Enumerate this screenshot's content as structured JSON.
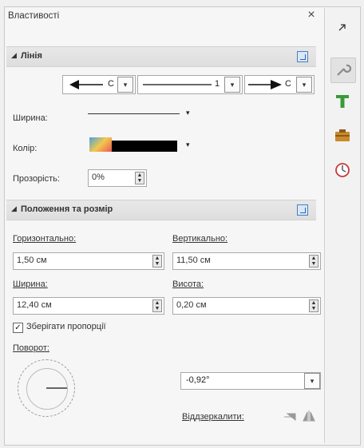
{
  "panel": {
    "title": "Властивості",
    "close_glyph": "×"
  },
  "line_section": {
    "header": "Лінія",
    "start_arrow_value": "С",
    "mid_value": "1",
    "end_arrow_value": "С",
    "width_label": "Ширина:",
    "color_label": "Колір:",
    "color_value": "#000000",
    "transparency_label": "Прозорість:",
    "transparency_value": "0%"
  },
  "position_section": {
    "header": "Положення та розмір",
    "horizontal_label": "Горизонтально:",
    "horizontal_value": "1,50 см",
    "vertical_label": "Вертикально:",
    "vertical_value": "11,50 см",
    "width_label": "Ширина:",
    "width_value": "12,40 см",
    "height_label": "Висота:",
    "height_value": "0,20 см",
    "keep_ratio_label": "Зберігати пропорції",
    "keep_ratio_checked": true,
    "rotation_label": "Поворот:",
    "rotation_value": "-0,92°",
    "flip_label": "Віддзеркалити:"
  },
  "sidebar": {
    "icons": [
      "wrench-icon",
      "text-t-icon",
      "gallery-icon",
      "navigator-icon"
    ]
  },
  "colors": {
    "accent": "#2f66ad",
    "green_t": "#3a9a3a",
    "gallery": "#c98a2c",
    "navigator": "#c83a3a"
  }
}
